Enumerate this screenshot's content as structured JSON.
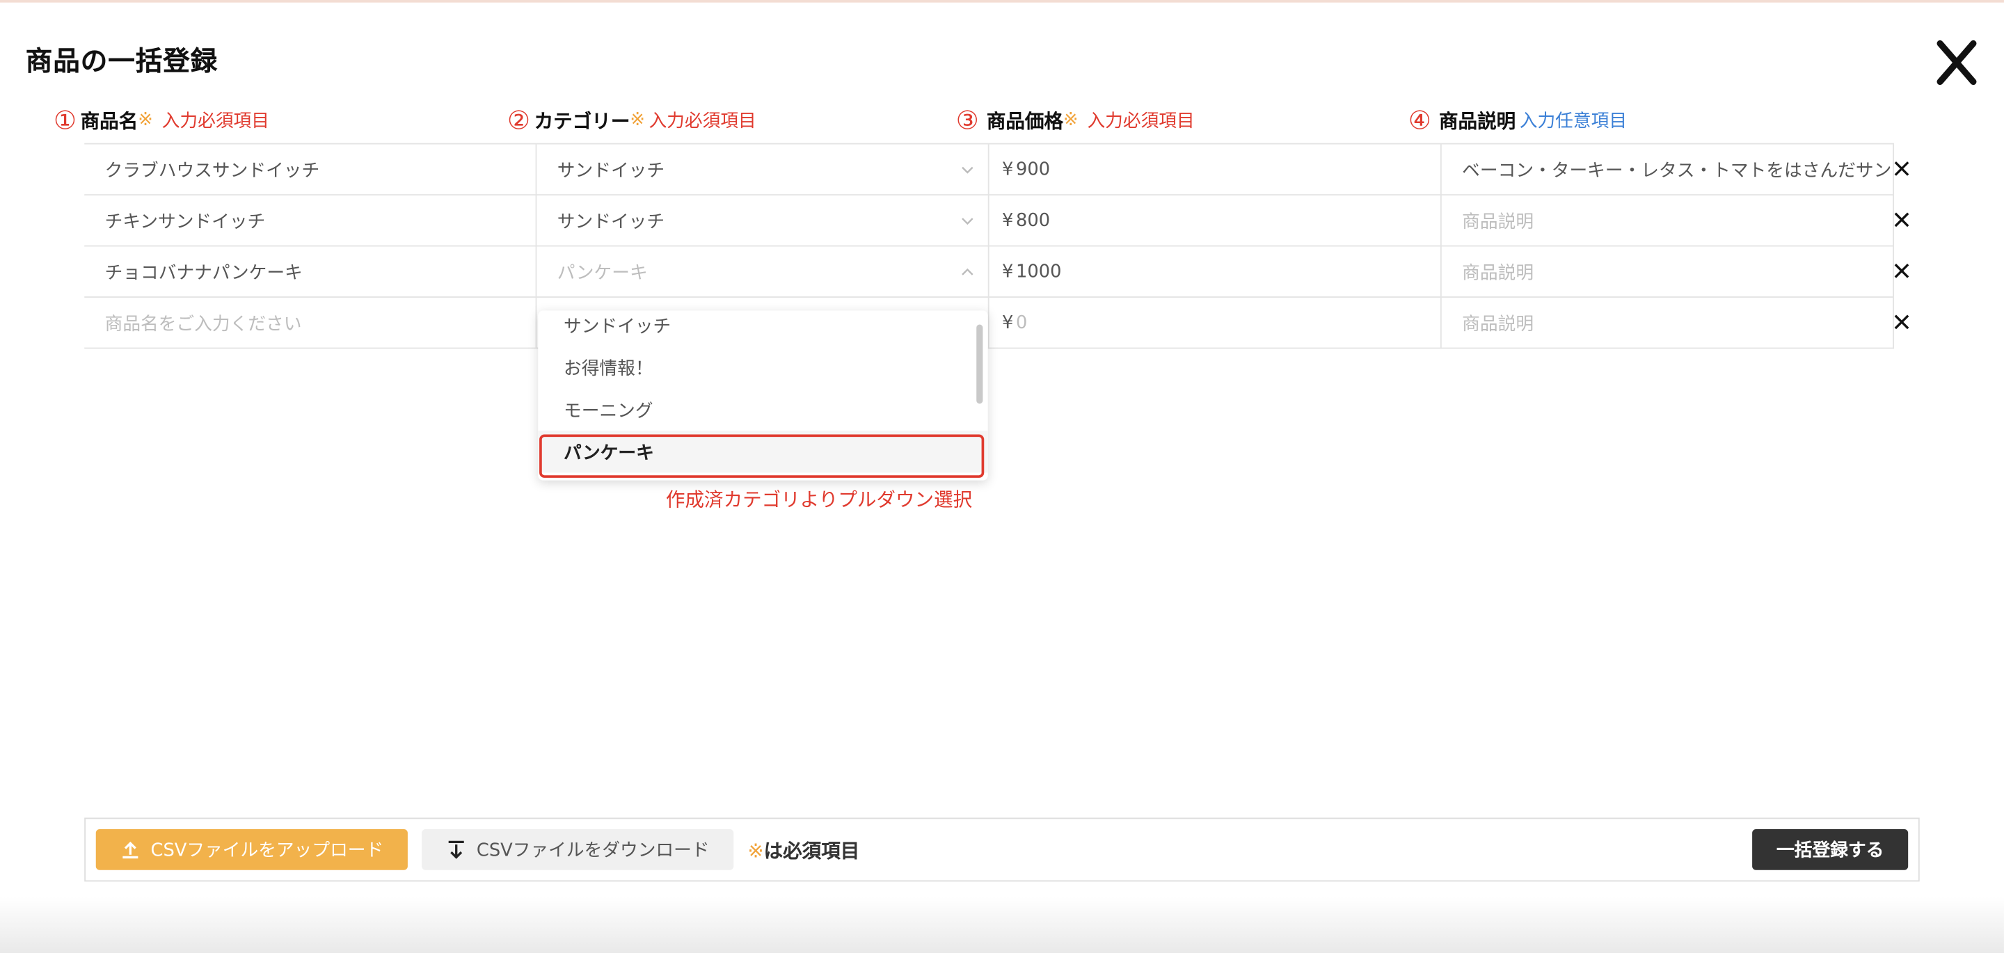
{
  "modal": {
    "title": "商品の一括登録"
  },
  "columns": [
    {
      "number": "①",
      "name": "商品名",
      "mark": "※",
      "note": "入力必須項目",
      "note_color": "#e03a2e"
    },
    {
      "number": "②",
      "name": "カテゴリー",
      "mark": "※",
      "note": "入力必須項目",
      "note_color": "#e03a2e"
    },
    {
      "number": "③",
      "name": "商品価格",
      "mark": "※",
      "note": "入力必須項目",
      "note_color": "#e03a2e"
    },
    {
      "number": "④",
      "name": "商品説明",
      "mark": "",
      "note": "入力任意項目",
      "note_color": "#3a7fd6"
    }
  ],
  "rows": [
    {
      "name": "クラブハウスサンドイッチ",
      "category": "サンドイッチ",
      "currency": "¥",
      "price": "900",
      "description": "ベーコン・ターキー・レタス・トマトをはさんだサン"
    },
    {
      "name": "チキンサンドイッチ",
      "category": "サンドイッチ",
      "currency": "¥",
      "price": "800",
      "description": ""
    },
    {
      "name": "チョコバナナパンケーキ",
      "category": "パンケーキ",
      "currency": "¥",
      "price": "1000",
      "description": ""
    },
    {
      "name": "",
      "category": "",
      "currency": "¥",
      "price": "",
      "description": ""
    }
  ],
  "placeholders": {
    "name": "商品名をご入力ください",
    "price": "0",
    "description": "商品説明"
  },
  "dropdown": {
    "options": [
      "サンドイッチ",
      "お得情報！",
      "モーニング",
      "パンケーキ"
    ],
    "selected": "パンケーキ",
    "annotation": "作成済カテゴリよりプルダウン選択"
  },
  "footer": {
    "upload_label": "CSVファイルをアップロード",
    "download_label": "CSVファイルをダウンロード",
    "required_mark": "※",
    "required_note": "は必須項目",
    "submit_label": "一括登録する"
  },
  "colors": {
    "accent_orange": "#f2b24b",
    "annotation_red": "#e03a2e",
    "optional_blue": "#3a7fd6",
    "submit_dark": "#333333"
  }
}
